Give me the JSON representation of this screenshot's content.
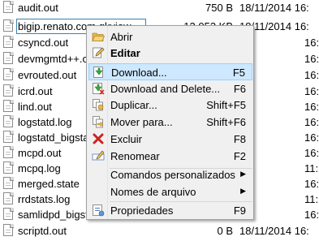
{
  "files": [
    {
      "name": "audit.out",
      "size": "750 B",
      "date": "18/11/2014 16:"
    },
    {
      "name": "bigip.renato.com.qkview",
      "size": "12.053 KB",
      "date": "18/11/2014 16:"
    },
    {
      "name": "csyncd.out",
      "size": "",
      "date": "16:"
    },
    {
      "name": "devmgmtd++.o",
      "size": "",
      "date": "16:"
    },
    {
      "name": "evrouted.out",
      "size": "",
      "date": "16:"
    },
    {
      "name": "icrd.out",
      "size": "",
      "date": "16:"
    },
    {
      "name": "lind.out",
      "size": "",
      "date": "16:"
    },
    {
      "name": "logstatd.log",
      "size": "",
      "date": "16:"
    },
    {
      "name": "logstatd_bigstat",
      "size": "",
      "date": "16:"
    },
    {
      "name": "mcpd.out",
      "size": "",
      "date": "16:"
    },
    {
      "name": "mcpq.log",
      "size": "",
      "date": "11:"
    },
    {
      "name": "merged.state",
      "size": "",
      "date": "16:"
    },
    {
      "name": "rrdstats.log",
      "size": "",
      "date": "11:"
    },
    {
      "name": "samlidpd_bigstat",
      "size": "",
      "date": "16:"
    },
    {
      "name": "scriptd.out",
      "size": "0 B",
      "date": "18/11/2014 16:"
    }
  ],
  "context_menu": {
    "items": [
      {
        "label": "Abrir",
        "shortcut": "",
        "icon": "folder-open-icon"
      },
      {
        "label": "Editar",
        "shortcut": "",
        "icon": "edit-icon"
      },
      {
        "label": "Download...",
        "shortcut": "F5",
        "icon": "download-icon"
      },
      {
        "label": "Download and Delete...",
        "shortcut": "F6",
        "icon": "download-delete-icon"
      },
      {
        "label": "Duplicar...",
        "shortcut": "Shift+F5",
        "icon": "duplicate-icon"
      },
      {
        "label": "Mover para...",
        "shortcut": "Shift+F6",
        "icon": "move-icon"
      },
      {
        "label": "Excluir",
        "shortcut": "F8",
        "icon": "delete-icon"
      },
      {
        "label": "Renomear",
        "shortcut": "F2",
        "icon": "rename-icon"
      },
      {
        "label": "Comandos personalizados",
        "shortcut": "",
        "icon": ""
      },
      {
        "label": "Nomes de arquivo",
        "shortcut": "",
        "icon": ""
      },
      {
        "label": "Propriedades",
        "shortcut": "F9",
        "icon": "properties-icon"
      }
    ],
    "highlighted_index": 2,
    "colors": {
      "highlight_bg": "#cde8ff",
      "highlight_border": "#99d1ff",
      "menu_bg": "#f0f0f0"
    }
  }
}
